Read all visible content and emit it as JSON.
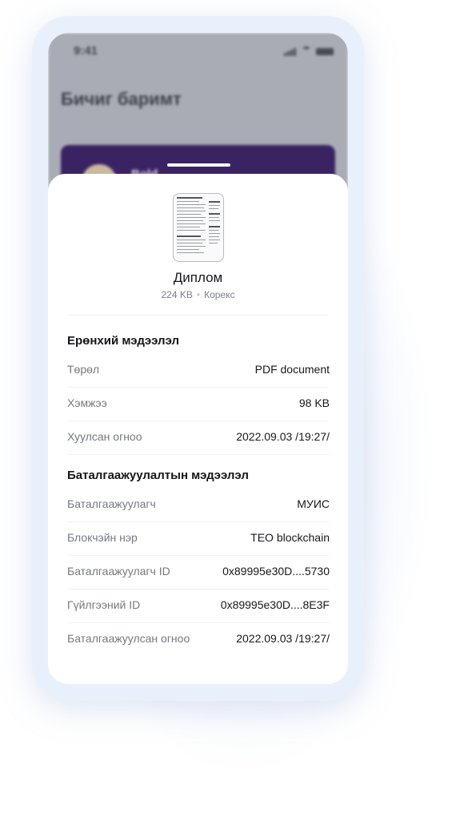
{
  "status_bar": {
    "time": "9:41"
  },
  "background_screen": {
    "title": "Бичиг баримт",
    "card_name": "Bold..."
  },
  "document": {
    "name": "Диплом",
    "size": "224 KB",
    "separator": "•",
    "type": "Корекс"
  },
  "general_info": {
    "title": "Ерөнхий мэдээлэл",
    "rows": [
      {
        "label": "Төрөл",
        "value": "PDF document"
      },
      {
        "label": "Хэмжээ",
        "value": "98 KB"
      },
      {
        "label": "Хуулсан огноо",
        "value": "2022.09.03 /19:27/"
      }
    ]
  },
  "verification_info": {
    "title": "Баталгаажуулалтын мэдээлэл",
    "rows": [
      {
        "label": "Баталгаажуулагч",
        "value": "МУИС"
      },
      {
        "label": "Блокчэйн нэр",
        "value": "TEO blockchain"
      },
      {
        "label": "Баталгаажуулагч ID",
        "value": "0x89995e30D....5730"
      },
      {
        "label": "Гүйлгээний ID",
        "value": "0x89995e30D....8E3F"
      },
      {
        "label": "Баталгаажуулсан огноо",
        "value": "2022.09.03 /19:27/"
      }
    ]
  },
  "colors": {
    "background_card": "#3a2362",
    "overlay": "#a9abb5",
    "frame": "#e8f1fb"
  }
}
